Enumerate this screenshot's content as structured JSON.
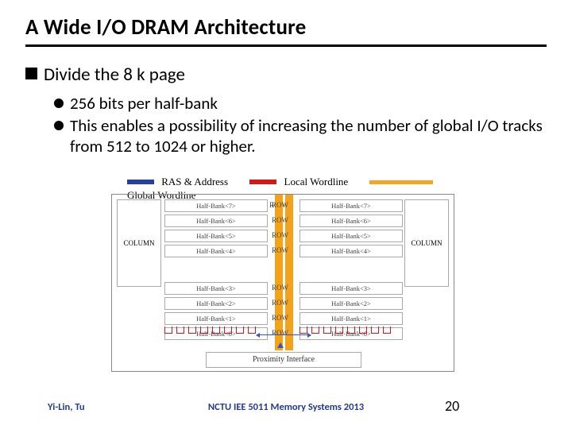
{
  "title": "A Wide I/O DRAM Architecture",
  "bullet1": "Divide the 8 k page",
  "sub1": "256 bits per half-bank",
  "sub2": "This enables a possibility of increasing the number of global I/O tracks from 512 to 1024 or higher.",
  "legend": {
    "ras": "RAS & Address",
    "local": "Local Wordline",
    "global": "Global Wordline"
  },
  "diagram": {
    "row": "ROW",
    "column": "COLUMN",
    "proximity": "Proximity Interface",
    "half_banks_left": [
      "Half-Bank<7>",
      "Half-Bank<6>",
      "Half-Bank<5>",
      "Half-Bank<4>",
      "Half-Bank<3>",
      "Half-Bank<2>",
      "Half-Bank<1>",
      "Half-Bank<0>"
    ],
    "half_banks_right": [
      "Half-Bank<7>",
      "Half-Bank<6>",
      "Half-Bank<5>",
      "Half-Bank<4>",
      "Half-Bank<3>",
      "Half-Bank<2>",
      "Half-Bank<1>",
      "Half-Bank<0>"
    ]
  },
  "footer": {
    "author": "Yi-Lin, Tu",
    "course": "NCTU IEE 5011 Memory Systems 2013",
    "page": "20"
  },
  "colors": {
    "ras": "#2a3f9a",
    "local": "#d01919",
    "global": "#f5a623",
    "footer": "#243a8f"
  }
}
